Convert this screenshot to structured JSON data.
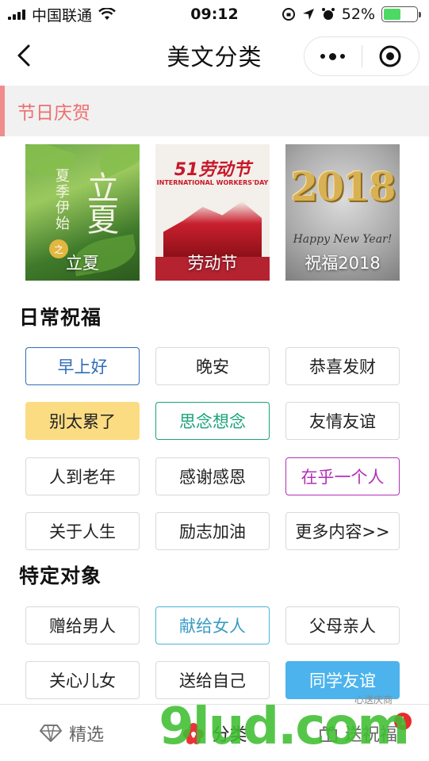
{
  "status_bar": {
    "carrier": "中国联通",
    "time": "09:12",
    "battery": "52%",
    "battery_level": 0.52
  },
  "nav": {
    "title": "美文分类"
  },
  "banner": {
    "label": "节日庆贺"
  },
  "featured": [
    {
      "caption": "立夏",
      "art_vertical": "夏季伊始",
      "art_big": "立夏",
      "art_seal": "之"
    },
    {
      "caption": "劳动节",
      "art_title": "51劳动节",
      "art_sub": "INTERNATIONAL WORKERS'DAY"
    },
    {
      "caption": "祝福2018",
      "art_year": "2018",
      "art_greeting": "Happy New Year!"
    }
  ],
  "sections": {
    "daily": "日常祝福",
    "specific": "特定对象"
  },
  "daily_tags": [
    "早上好",
    "晚安",
    "恭喜发财",
    "别太累了",
    "思念想念",
    "友情友谊",
    "人到老年",
    "感谢感恩",
    "在乎一个人",
    "关于人生",
    "励志加油",
    "更多内容>>"
  ],
  "specific_tags": [
    "赠给男人",
    "献给女人",
    "父母亲人",
    "关心儿女",
    "送给自己",
    "同学友谊"
  ],
  "tabs": [
    {
      "label": "精选",
      "icon": "diamond-icon"
    },
    {
      "label": "分类",
      "icon": "flower-icon"
    },
    {
      "label": "送祝福",
      "icon": "gift-icon",
      "badge": "1"
    }
  ],
  "watermark": {
    "text": "9lud.com",
    "small": "心送庆商"
  },
  "colors": {
    "accent_red": "#ee6f6f",
    "active_blue": "#4cb3ec",
    "highlight_yellow": "#fbdc83",
    "watermark_green": "#3fbf32"
  }
}
